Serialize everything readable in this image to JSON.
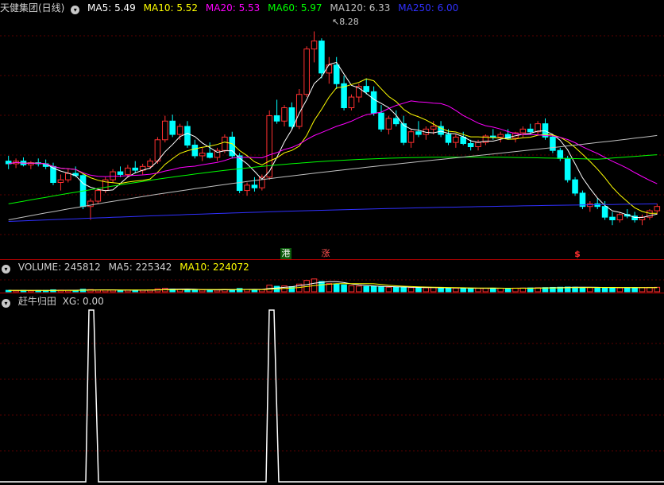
{
  "main_header": {
    "stock": "天健集团(日线)",
    "ma5": {
      "label": "MA5: 5.49",
      "color": "#ffffff"
    },
    "ma10": {
      "label": "MA10: 5.52",
      "color": "#ffff00"
    },
    "ma20": {
      "label": "MA20: 5.53",
      "color": "#ff00ff"
    },
    "ma60": {
      "label": "MA60: 5.97",
      "color": "#00ff00"
    },
    "ma120": {
      "label": "MA120: 6.33",
      "color": "#c0c0c0"
    },
    "ma250": {
      "label": "MA250: 6.00",
      "color": "#3030ff"
    }
  },
  "peak_label": "8.28",
  "markers": {
    "gang": "港",
    "zhang": "涨",
    "s": "$"
  },
  "volume_header": {
    "label": "VOLUME: 245812",
    "ma5": "MA5: 225342",
    "ma10": "MA10: 224072"
  },
  "xg_header": {
    "name": "赶牛归田",
    "value": "XG: 0.00"
  },
  "colors": {
    "up": "#ff3030",
    "down": "#00ffff",
    "divider": "#b00000"
  },
  "chart_data": {
    "type": "candlestick",
    "count": 88,
    "ylim": [
      4.4,
      8.6
    ],
    "candles_ohlc": [
      [
        5.85,
        5.95,
        5.7,
        5.8
      ],
      [
        5.8,
        5.9,
        5.72,
        5.85
      ],
      [
        5.85,
        5.92,
        5.75,
        5.78
      ],
      [
        5.78,
        5.85,
        5.7,
        5.82
      ],
      [
        5.82,
        5.9,
        5.75,
        5.8
      ],
      [
        5.8,
        5.88,
        5.7,
        5.75
      ],
      [
        5.75,
        5.82,
        5.4,
        5.45
      ],
      [
        5.45,
        5.6,
        5.3,
        5.5
      ],
      [
        5.5,
        5.7,
        5.45,
        5.62
      ],
      [
        5.62,
        5.75,
        5.55,
        5.58
      ],
      [
        5.58,
        5.62,
        4.95,
        5.0
      ],
      [
        5.0,
        5.15,
        4.75,
        5.1
      ],
      [
        5.1,
        5.35,
        5.05,
        5.3
      ],
      [
        5.3,
        5.55,
        5.25,
        5.5
      ],
      [
        5.5,
        5.7,
        5.45,
        5.65
      ],
      [
        5.65,
        5.75,
        5.55,
        5.6
      ],
      [
        5.6,
        5.78,
        5.55,
        5.72
      ],
      [
        5.72,
        5.85,
        5.62,
        5.68
      ],
      [
        5.68,
        5.8,
        5.6,
        5.75
      ],
      [
        5.75,
        5.9,
        5.7,
        5.85
      ],
      [
        5.85,
        6.3,
        5.8,
        6.25
      ],
      [
        6.25,
        6.7,
        6.2,
        6.6
      ],
      [
        6.6,
        6.72,
        6.3,
        6.35
      ],
      [
        6.35,
        6.55,
        6.25,
        6.5
      ],
      [
        6.5,
        6.6,
        6.1,
        6.15
      ],
      [
        6.15,
        6.25,
        5.9,
        5.95
      ],
      [
        5.95,
        6.1,
        5.85,
        6.0
      ],
      [
        6.0,
        6.2,
        5.9,
        5.92
      ],
      [
        5.92,
        6.1,
        5.85,
        6.05
      ],
      [
        6.05,
        6.35,
        6.0,
        6.3
      ],
      [
        6.3,
        6.4,
        5.9,
        5.95
      ],
      [
        5.95,
        6.0,
        5.25,
        5.3
      ],
      [
        5.3,
        5.45,
        5.2,
        5.4
      ],
      [
        5.4,
        5.55,
        5.28,
        5.35
      ],
      [
        5.35,
        5.6,
        5.3,
        5.55
      ],
      [
        5.55,
        6.8,
        5.5,
        6.7
      ],
      [
        6.7,
        7.0,
        6.55,
        6.6
      ],
      [
        6.6,
        6.9,
        6.5,
        6.85
      ],
      [
        6.85,
        6.95,
        6.45,
        6.5
      ],
      [
        6.5,
        7.2,
        6.45,
        7.1
      ],
      [
        7.1,
        8.0,
        7.05,
        7.95
      ],
      [
        7.95,
        8.28,
        7.7,
        8.1
      ],
      [
        8.1,
        8.15,
        7.4,
        7.5
      ],
      [
        7.5,
        7.8,
        7.3,
        7.65
      ],
      [
        7.65,
        7.8,
        7.2,
        7.3
      ],
      [
        7.3,
        7.45,
        6.8,
        6.85
      ],
      [
        6.85,
        7.1,
        6.8,
        7.05
      ],
      [
        7.05,
        7.3,
        6.95,
        7.25
      ],
      [
        7.25,
        7.4,
        7.1,
        7.15
      ],
      [
        7.15,
        7.25,
        6.7,
        6.75
      ],
      [
        6.75,
        6.9,
        6.4,
        6.45
      ],
      [
        6.45,
        6.7,
        6.35,
        6.65
      ],
      [
        6.65,
        6.8,
        6.5,
        6.55
      ],
      [
        6.55,
        6.7,
        6.15,
        6.2
      ],
      [
        6.2,
        6.45,
        6.1,
        6.4
      ],
      [
        6.4,
        6.6,
        6.3,
        6.35
      ],
      [
        6.35,
        6.5,
        6.25,
        6.45
      ],
      [
        6.45,
        6.6,
        6.35,
        6.5
      ],
      [
        6.5,
        6.6,
        6.3,
        6.35
      ],
      [
        6.35,
        6.45,
        6.15,
        6.2
      ],
      [
        6.2,
        6.35,
        6.1,
        6.3
      ],
      [
        6.3,
        6.4,
        6.15,
        6.18
      ],
      [
        6.18,
        6.25,
        6.05,
        6.12
      ],
      [
        6.12,
        6.25,
        6.05,
        6.2
      ],
      [
        6.2,
        6.35,
        6.15,
        6.32
      ],
      [
        6.32,
        6.45,
        6.25,
        6.3
      ],
      [
        6.3,
        6.4,
        6.2,
        6.35
      ],
      [
        6.35,
        6.45,
        6.25,
        6.28
      ],
      [
        6.28,
        6.4,
        6.2,
        6.38
      ],
      [
        6.38,
        6.5,
        6.3,
        6.45
      ],
      [
        6.45,
        6.55,
        6.35,
        6.4
      ],
      [
        6.4,
        6.6,
        6.35,
        6.55
      ],
      [
        6.55,
        6.65,
        6.25,
        6.3
      ],
      [
        6.3,
        6.35,
        6.0,
        6.05
      ],
      [
        6.05,
        6.1,
        5.85,
        5.9
      ],
      [
        5.9,
        5.95,
        5.45,
        5.5
      ],
      [
        5.5,
        5.55,
        5.2,
        5.25
      ],
      [
        5.25,
        5.3,
        4.95,
        5.0
      ],
      [
        5.0,
        5.1,
        4.9,
        5.05
      ],
      [
        5.05,
        5.15,
        4.95,
        5.0
      ],
      [
        5.0,
        5.1,
        4.75,
        4.8
      ],
      [
        4.8,
        4.9,
        4.65,
        4.75
      ],
      [
        4.75,
        4.88,
        4.7,
        4.85
      ],
      [
        4.85,
        4.95,
        4.78,
        4.82
      ],
      [
        4.82,
        4.9,
        4.7,
        4.75
      ],
      [
        4.75,
        4.85,
        4.65,
        4.8
      ],
      [
        4.8,
        4.95,
        4.75,
        4.92
      ],
      [
        4.92,
        5.05,
        4.85,
        5.0
      ]
    ],
    "ma_series": [
      {
        "name": "MA5",
        "color": "#ffffff"
      },
      {
        "name": "MA10",
        "color": "#ffff00"
      },
      {
        "name": "MA20",
        "color": "#ff00ff"
      },
      {
        "name": "MA60",
        "color": "#00ff00",
        "start": 5.05,
        "end": 5.97
      },
      {
        "name": "MA120",
        "color": "#c0c0c0",
        "start": 4.75,
        "end": 6.33
      },
      {
        "name": "MA250",
        "color": "#3030ff",
        "start": 4.72,
        "end": 5.05
      }
    ],
    "volume_ylim": [
      0,
      1000000
    ],
    "volume": [
      80000,
      70000,
      75000,
      65000,
      70000,
      75000,
      110000,
      90000,
      85000,
      80000,
      140000,
      120000,
      100000,
      95000,
      90000,
      85000,
      95000,
      90000,
      85000,
      100000,
      160000,
      190000,
      150000,
      130000,
      120000,
      110000,
      100000,
      105000,
      95000,
      130000,
      120000,
      180000,
      130000,
      110000,
      120000,
      360000,
      300000,
      320000,
      280000,
      420000,
      620000,
      700000,
      560000,
      450000,
      420000,
      380000,
      330000,
      310000,
      290000,
      300000,
      270000,
      250000,
      260000,
      240000,
      230000,
      220000,
      220000,
      230000,
      210000,
      200000,
      200000,
      190000,
      185000,
      190000,
      195000,
      200000,
      195000,
      190000,
      200000,
      205000,
      210000,
      220000,
      230000,
      240000,
      250000,
      260000,
      250000,
      240000,
      230000,
      225000,
      230000,
      220000,
      215000,
      225000,
      230000,
      235000,
      240000,
      245812
    ],
    "xg_ylim": [
      0,
      1
    ],
    "xg_pulses": [
      {
        "rise": 108,
        "top_start": 112,
        "top_end": 118,
        "fall": 124
      },
      {
        "rise": 335,
        "top_start": 339,
        "top_end": 345,
        "fall": 351
      }
    ],
    "marker_indices": {
      "gang": 35,
      "zhang": 41,
      "s": 73
    }
  }
}
